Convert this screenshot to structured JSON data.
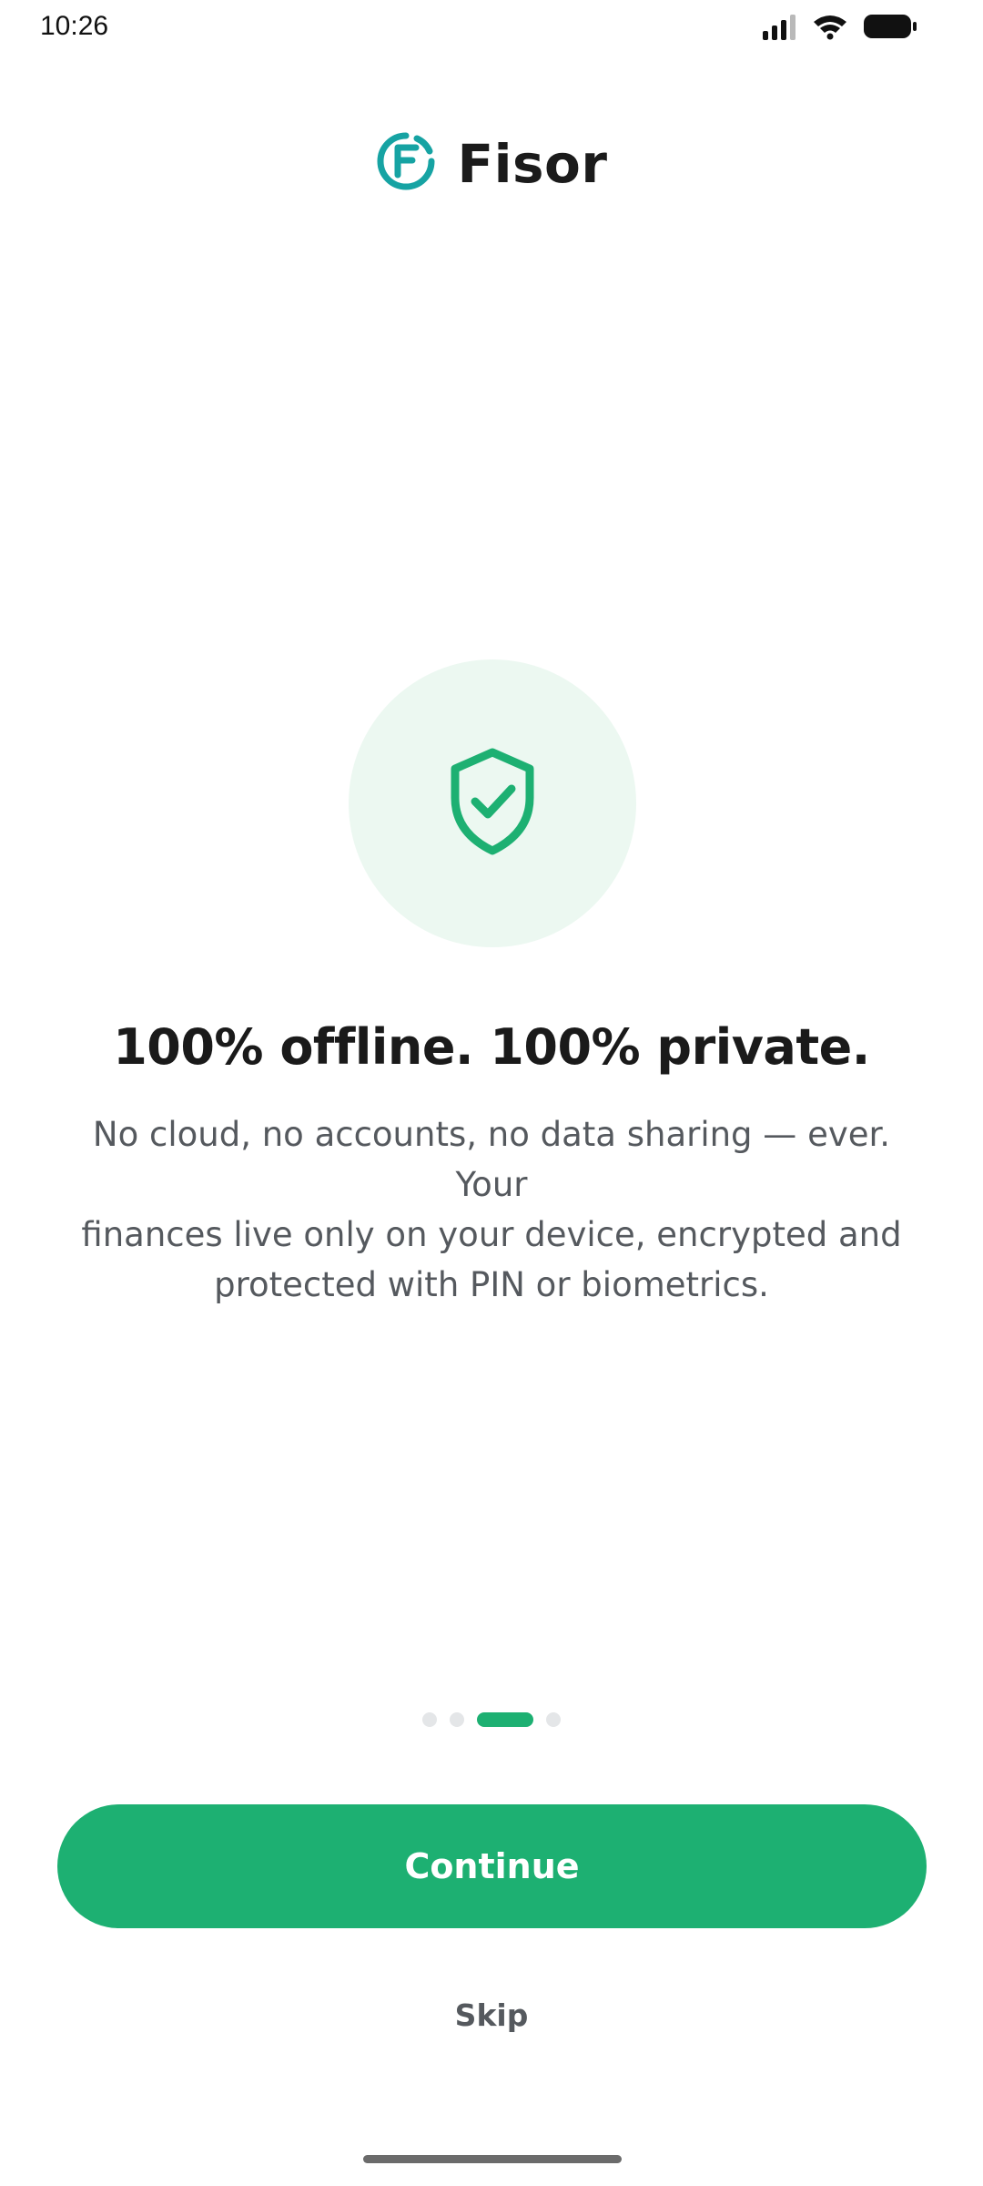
{
  "status_bar": {
    "time": "10:26",
    "icons": [
      "signal-icon",
      "wifi-icon",
      "battery-icon"
    ]
  },
  "brand": {
    "name": "Fisor",
    "logo_icon": "fisor-logo-icon",
    "logo_color": "#16a3a3"
  },
  "onboarding": {
    "hero_icon": "shield-check-icon",
    "headline": "100% offline. 100% private.",
    "body_lines": [
      "No cloud, no accounts, no data sharing — ever. Your",
      "finances live only on your device, encrypted and",
      "protected with PIN or biometrics."
    ],
    "pager": {
      "total_pages": 4,
      "current_page": 3
    }
  },
  "actions": {
    "continue_label": "Continue",
    "skip_label": "Skip"
  },
  "colors": {
    "accent": "#1db072",
    "hero_bg": "#ecf8f1",
    "body_text": "#55595e"
  }
}
